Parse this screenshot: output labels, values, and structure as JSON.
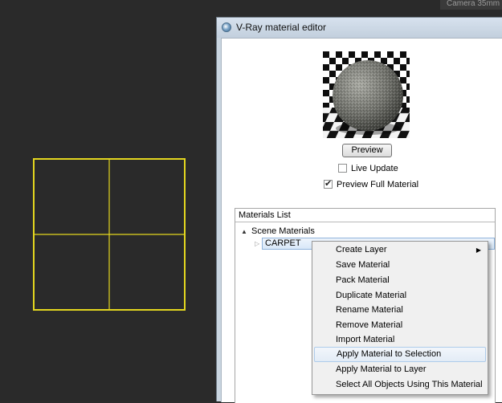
{
  "viewport": {
    "camera_label": "Camera 35mm (",
    "grid_color": "#e3d61f"
  },
  "editor": {
    "title": "V-Ray material editor",
    "preview_button": "Preview",
    "live_update_label": "Live Update",
    "live_update_checked": false,
    "preview_full_label": "Preview Full Material",
    "preview_full_checked": true
  },
  "materials_list": {
    "header": "Materials List",
    "scene_label": "Scene Materials",
    "items": [
      "CARPET"
    ]
  },
  "context_menu": {
    "items": [
      {
        "label": "Create Layer",
        "submenu": true
      },
      {
        "label": "Save Material"
      },
      {
        "label": "Pack Material"
      },
      {
        "label": "Duplicate Material"
      },
      {
        "label": "Rename Material"
      },
      {
        "label": "Remove Material"
      },
      {
        "label": "Import Material"
      },
      {
        "label": "Apply Material to Selection",
        "highlighted": true
      },
      {
        "label": "Apply Material to Layer"
      },
      {
        "label": "Select All Objects Using This Material"
      }
    ]
  },
  "icons": {
    "tree_expanded": "triangle-down-icon",
    "tree_collapsed": "triangle-right-icon",
    "submenu": "triangle-right-icon",
    "checkmark": "checkmark-icon"
  }
}
